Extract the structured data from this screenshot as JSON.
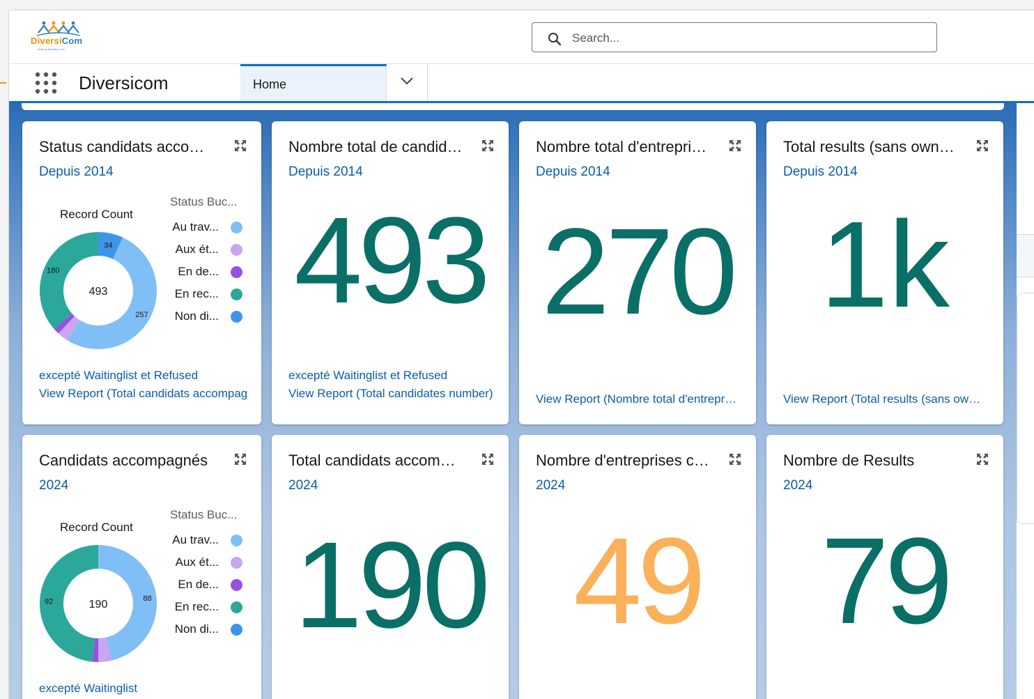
{
  "header": {
    "logo_name_part1": "Diversi",
    "logo_name_part2": "Com",
    "logo_tagline": "Making disability work",
    "search_placeholder": "Search..."
  },
  "nav": {
    "app_name": "Diversicom",
    "tab_home": "Home"
  },
  "colors": {
    "teal": "#0a6f66",
    "orange": "#fbb05a",
    "link": "#0b5cab",
    "legend": [
      "#80bff5",
      "#c7a6f2",
      "#9750e0",
      "#2ba899",
      "#3d95e8"
    ]
  },
  "cards": [
    {
      "title": "Status candidats accompagnés",
      "subtitle": "Depuis 2014",
      "note": "excepté Waitinglist et Refused",
      "view_report": "View Report (Total candidats accompagnés)"
    },
    {
      "title": "Nombre total de candidats",
      "subtitle": "Depuis 2014",
      "metric": "493",
      "note": "excepté Waitinglist et Refused",
      "view_report": "View Report (Total candidates number)"
    },
    {
      "title": "Nombre total d'entreprises",
      "subtitle": "Depuis 2014",
      "metric": "270",
      "view_report": "View Report (Nombre total d'entreprises)"
    },
    {
      "title": "Total results (sans owner)",
      "subtitle": "Depuis 2014",
      "metric": "1k",
      "view_report": "View Report (Total results (sans owner))"
    },
    {
      "title": "Candidats accompagnés",
      "subtitle": "2024",
      "note": "excepté Waitinglist"
    },
    {
      "title": "Total candidats accompagnés",
      "subtitle": "2024",
      "metric": "190"
    },
    {
      "title": "Nombre d'entreprises contactées",
      "subtitle": "2024",
      "metric": "49"
    },
    {
      "title": "Nombre de Results",
      "subtitle": "2024",
      "metric": "79"
    }
  ],
  "chart_data": [
    {
      "type": "pie",
      "variant": "donut",
      "center_label": "493",
      "measure_label": "Record Count",
      "legend_title": "Status Buc...",
      "legend_position": "right",
      "categories": [
        "Au trav...",
        "Aux ét...",
        "En de...",
        "En rec...",
        "Non di..."
      ],
      "values": [
        257,
        15,
        8,
        180,
        34
      ],
      "data_labels": [
        "257",
        "",
        "",
        "180",
        "34"
      ]
    },
    {
      "type": "pie",
      "variant": "donut",
      "center_label": "190",
      "measure_label": "Record Count",
      "legend_title": "Status Buc...",
      "legend_position": "right",
      "categories": [
        "Au trav...",
        "Aux ét...",
        "En de...",
        "En rec...",
        "Non di..."
      ],
      "values": [
        88,
        7,
        3,
        92,
        0
      ],
      "data_labels": [
        "88",
        "",
        "",
        "92",
        ""
      ]
    }
  ]
}
